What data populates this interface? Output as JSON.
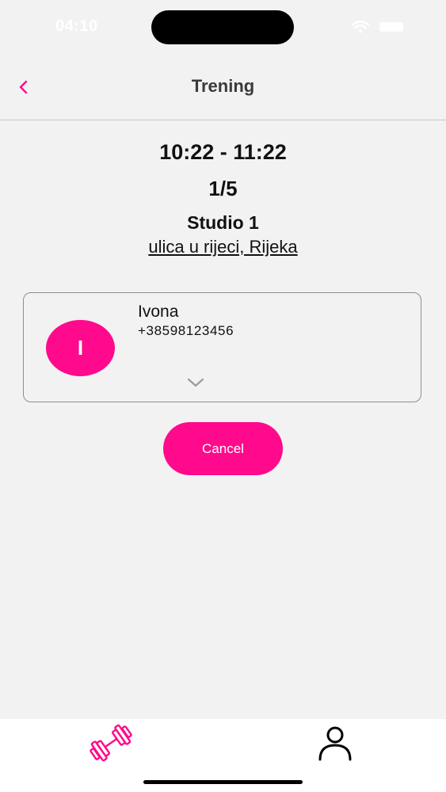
{
  "status_bar": {
    "time": "04:10"
  },
  "nav": {
    "title": "Trening"
  },
  "session": {
    "time_range": "10:22 - 11:22",
    "capacity": "1/5",
    "studio": "Studio 1",
    "address": "ulica u rijeci, Rijeka"
  },
  "attendee": {
    "initial": "I",
    "name": "Ivona",
    "phone": "+38598123456"
  },
  "actions": {
    "cancel_label": "Cancel"
  },
  "tab_bar": {
    "tabs": [
      {
        "id": "training",
        "icon": "dumbbell-icon",
        "active": true
      },
      {
        "id": "profile",
        "icon": "person-icon",
        "active": false
      }
    ]
  },
  "colors": {
    "accent": "#ff0a8c",
    "background": "#f2f2f2",
    "text": "#111111"
  }
}
